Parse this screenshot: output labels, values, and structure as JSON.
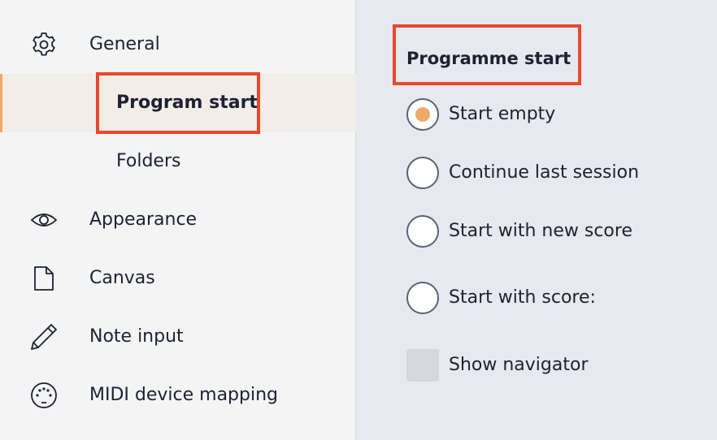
{
  "sidebar": {
    "items": [
      {
        "label": "General",
        "icon": "gear-icon"
      },
      {
        "label": "Program start",
        "selected": true
      },
      {
        "label": "Folders"
      },
      {
        "label": "Appearance",
        "icon": "eye-icon"
      },
      {
        "label": "Canvas",
        "icon": "document-icon"
      },
      {
        "label": "Note input",
        "icon": "pencil-icon"
      },
      {
        "label": "MIDI device mapping",
        "icon": "midi-icon"
      }
    ]
  },
  "main": {
    "section_title": "Programme start",
    "options": [
      {
        "label": "Start empty",
        "type": "radio",
        "checked": true
      },
      {
        "label": "Continue last session",
        "type": "radio",
        "checked": false
      },
      {
        "label": "Start with new score",
        "type": "radio",
        "checked": false
      },
      {
        "label": "Start with score:",
        "type": "radio",
        "checked": false
      },
      {
        "label": "Show navigator",
        "type": "checkbox",
        "checked": false
      }
    ]
  },
  "colors": {
    "accent": "#eeaa6a",
    "highlight_box": "#e8482c",
    "selected_background": "#f3ede7",
    "sidebar_background": "#f4f4f5",
    "main_background": "#e8e9ee"
  }
}
